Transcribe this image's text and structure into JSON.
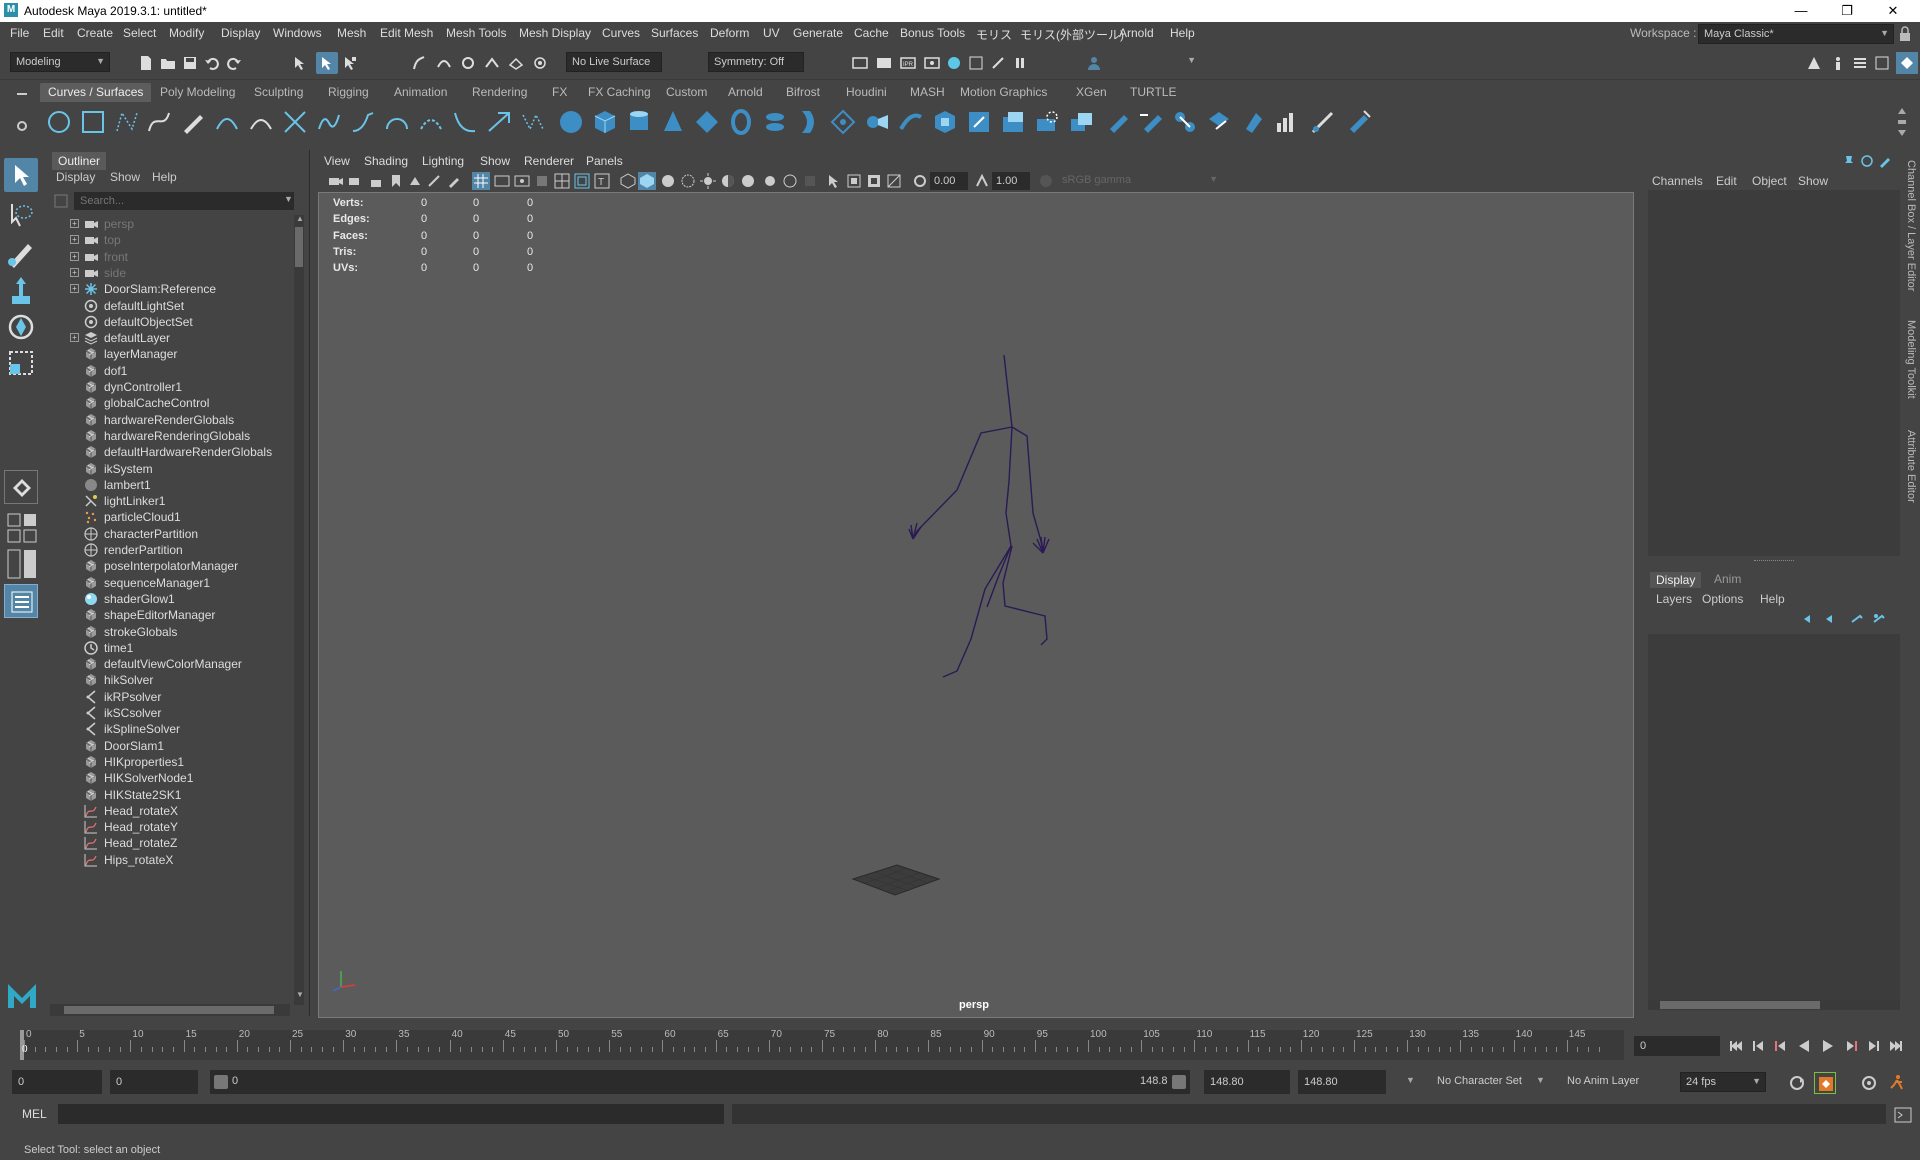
{
  "window": {
    "title": "Autodesk Maya 2019.3.1: untitled*",
    "logo": "M",
    "controls": [
      "—",
      "❐",
      "✕"
    ]
  },
  "menubar": {
    "items": [
      "File",
      "Edit",
      "Create",
      "Select",
      "Modify",
      "Display",
      "Windows",
      "Mesh",
      "Edit Mesh",
      "Mesh Tools",
      "Mesh Display",
      "Curves",
      "Surfaces",
      "Deform",
      "UV",
      "Generate",
      "Cache",
      "Bonus Tools",
      "モリス",
      "モリス(外部ツール)",
      "Arnold",
      "Help"
    ],
    "workspace_label": "Workspace :",
    "workspace_value": "Maya Classic*"
  },
  "statusline": {
    "menuset": "Modeling",
    "live_surface": "No Live Surface",
    "symmetry": "Symmetry: Off"
  },
  "shelf": {
    "tabs": [
      "Curves / Surfaces",
      "Poly Modeling",
      "Sculpting",
      "Rigging",
      "Animation",
      "Rendering",
      "FX",
      "FX Caching",
      "Custom",
      "Arnold",
      "Bifrost",
      "Houdini",
      "MASH",
      "Motion Graphics",
      "XGen",
      "TURTLE"
    ],
    "active_tab": "Curves / Surfaces"
  },
  "outliner": {
    "title": "Outliner",
    "menus": [
      "Display",
      "Show",
      "Help"
    ],
    "search_placeholder": "Search...",
    "items": [
      {
        "label": "persp",
        "icon": "camera-icon",
        "expandable": true,
        "dim": true
      },
      {
        "label": "top",
        "icon": "camera-icon",
        "expandable": true,
        "dim": true
      },
      {
        "label": "front",
        "icon": "camera-icon",
        "expandable": true,
        "dim": true
      },
      {
        "label": "side",
        "icon": "camera-icon",
        "expandable": true,
        "dim": true
      },
      {
        "label": "DoorSlam:Reference",
        "icon": "reference-star-icon",
        "expandable": true,
        "dim": false
      },
      {
        "label": "defaultLightSet",
        "icon": "set-icon",
        "expandable": false,
        "dim": false
      },
      {
        "label": "defaultObjectSet",
        "icon": "set-icon",
        "expandable": false,
        "dim": false
      },
      {
        "label": "defaultLayer",
        "icon": "layer-icon",
        "expandable": true,
        "dim": false
      },
      {
        "label": "layerManager",
        "icon": "node-icon",
        "expandable": false,
        "dim": false
      },
      {
        "label": "dof1",
        "icon": "node-icon",
        "expandable": false,
        "dim": false
      },
      {
        "label": "dynController1",
        "icon": "node-icon",
        "expandable": false,
        "dim": false
      },
      {
        "label": "globalCacheControl",
        "icon": "node-icon",
        "expandable": false,
        "dim": false
      },
      {
        "label": "hardwareRenderGlobals",
        "icon": "node-icon",
        "expandable": false,
        "dim": false
      },
      {
        "label": "hardwareRenderingGlobals",
        "icon": "node-icon",
        "expandable": false,
        "dim": false
      },
      {
        "label": "defaultHardwareRenderGlobals",
        "icon": "node-icon",
        "expandable": false,
        "dim": false
      },
      {
        "label": "ikSystem",
        "icon": "node-icon",
        "expandable": false,
        "dim": false
      },
      {
        "label": "lambert1",
        "icon": "shader-sphere-icon",
        "expandable": false,
        "dim": false
      },
      {
        "label": "lightLinker1",
        "icon": "light-linker-icon",
        "expandable": false,
        "dim": false
      },
      {
        "label": "particleCloud1",
        "icon": "particle-icon",
        "expandable": false,
        "dim": false
      },
      {
        "label": "characterPartition",
        "icon": "partition-icon",
        "expandable": false,
        "dim": false
      },
      {
        "label": "renderPartition",
        "icon": "partition-icon",
        "expandable": false,
        "dim": false
      },
      {
        "label": "poseInterpolatorManager",
        "icon": "node-icon",
        "expandable": false,
        "dim": false
      },
      {
        "label": "sequenceManager1",
        "icon": "node-icon",
        "expandable": false,
        "dim": false
      },
      {
        "label": "shaderGlow1",
        "icon": "glow-sphere-icon",
        "expandable": false,
        "dim": false
      },
      {
        "label": "shapeEditorManager",
        "icon": "node-icon",
        "expandable": false,
        "dim": false
      },
      {
        "label": "strokeGlobals",
        "icon": "node-icon",
        "expandable": false,
        "dim": false
      },
      {
        "label": "time1",
        "icon": "clock-icon",
        "expandable": false,
        "dim": false
      },
      {
        "label": "defaultViewColorManager",
        "icon": "node-icon",
        "expandable": false,
        "dim": false
      },
      {
        "label": "hikSolver",
        "icon": "node-icon",
        "expandable": false,
        "dim": false
      },
      {
        "label": "ikRPsolver",
        "icon": "ik-solver-icon",
        "expandable": false,
        "dim": false
      },
      {
        "label": "ikSCsolver",
        "icon": "ik-solver-icon",
        "expandable": false,
        "dim": false
      },
      {
        "label": "ikSplineSolver",
        "icon": "ik-solver-icon",
        "expandable": false,
        "dim": false
      },
      {
        "label": "DoorSlam1",
        "icon": "node-icon",
        "expandable": false,
        "dim": false
      },
      {
        "label": "HIKproperties1",
        "icon": "node-icon",
        "expandable": false,
        "dim": false
      },
      {
        "label": "HIKSolverNode1",
        "icon": "node-icon",
        "expandable": false,
        "dim": false
      },
      {
        "label": "HIKState2SK1",
        "icon": "node-icon",
        "expandable": false,
        "dim": false
      },
      {
        "label": "Head_rotateX",
        "icon": "anim-curve-icon",
        "expandable": false,
        "dim": false
      },
      {
        "label": "Head_rotateY",
        "icon": "anim-curve-icon",
        "expandable": false,
        "dim": false
      },
      {
        "label": "Head_rotateZ",
        "icon": "anim-curve-icon",
        "expandable": false,
        "dim": false
      },
      {
        "label": "Hips_rotateX",
        "icon": "anim-curve-icon",
        "expandable": false,
        "dim": false
      }
    ]
  },
  "viewport": {
    "menus": [
      "View",
      "Shading",
      "Lighting",
      "Show",
      "Renderer",
      "Panels"
    ],
    "exposure": "0.00",
    "gamma": "1.00",
    "colorspace": "sRGB gamma",
    "hud": [
      {
        "label": "Verts:",
        "v1": "0",
        "v2": "0",
        "v3": "0"
      },
      {
        "label": "Edges:",
        "v1": "0",
        "v2": "0",
        "v3": "0"
      },
      {
        "label": "Faces:",
        "v1": "0",
        "v2": "0",
        "v3": "0"
      },
      {
        "label": "Tris:",
        "v1": "0",
        "v2": "0",
        "v3": "0"
      },
      {
        "label": "UVs:",
        "v1": "0",
        "v2": "0",
        "v3": "0"
      }
    ],
    "camera": "persp",
    "skeleton_color": "#2a1a55"
  },
  "channelbox": {
    "menus": [
      "Channels",
      "Edit",
      "Object",
      "Show"
    ],
    "layer_tabs": [
      "Display",
      "Anim"
    ],
    "layer_menus": [
      "Layers",
      "Options",
      "Help"
    ],
    "side_tabs": [
      "Channel Box / Layer Editor",
      "Modeling Toolkit",
      "Attribute Editor"
    ]
  },
  "timeline": {
    "ticks": [
      0,
      5,
      10,
      15,
      20,
      25,
      30,
      35,
      40,
      45,
      50,
      55,
      60,
      65,
      70,
      75,
      80,
      85,
      90,
      95,
      100,
      105,
      110,
      115,
      120,
      125,
      130,
      135,
      140,
      145
    ],
    "current_frame_marker": "0",
    "current_frame": "0",
    "range_start": "0",
    "playback_start": "0",
    "slider_start": "0",
    "slider_end": "148.8",
    "playback_end": "148.80",
    "range_end": "148.80",
    "character_set": "No Character Set",
    "anim_layer": "No Anim Layer",
    "fps": "24 fps"
  },
  "cmdline": {
    "label": "MEL"
  },
  "helpline": {
    "text": "Select Tool: select an object"
  }
}
